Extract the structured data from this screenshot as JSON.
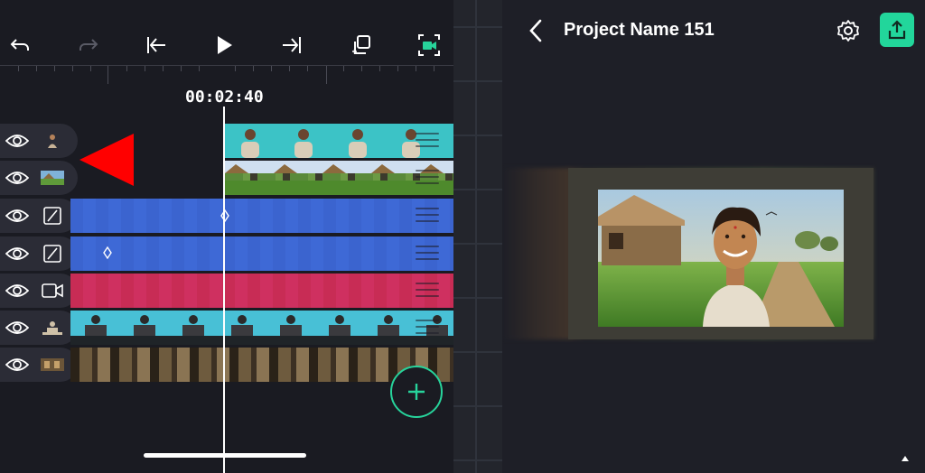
{
  "timeline": {
    "timecode": "00:02:40",
    "tracks": [
      {
        "type": "figure-overlay",
        "thumb_icon": "person-thumbnail-icon"
      },
      {
        "type": "image-overlay",
        "thumb_icon": "village-thumbnail-icon"
      },
      {
        "type": "adjustment",
        "thumb_icon": "adjustment-layer-icon"
      },
      {
        "type": "adjustment",
        "thumb_icon": "adjustment-layer-icon"
      },
      {
        "type": "camera",
        "thumb_icon": "camera-icon"
      },
      {
        "type": "video",
        "thumb_icon": "man-at-desk-thumbnail-icon"
      },
      {
        "type": "video",
        "thumb_icon": "dark-room-thumbnail-icon"
      }
    ]
  },
  "toolbar": {
    "icons": [
      "undo-icon",
      "redo-icon",
      "skip-to-start-icon",
      "play-icon",
      "skip-to-end-icon",
      "copy-icon",
      "camera-focus-icon"
    ]
  },
  "preview": {
    "project_title": "Project Name 151",
    "back_icon": "chevron-left-icon",
    "settings_icon": "gear-icon",
    "export_icon": "upload-icon"
  },
  "colors": {
    "accent": "#22d69b",
    "track_teal": "#3cc3c6",
    "track_blue": "#3b64cf",
    "track_red": "#c82c55",
    "arrow": "#ff0000"
  }
}
